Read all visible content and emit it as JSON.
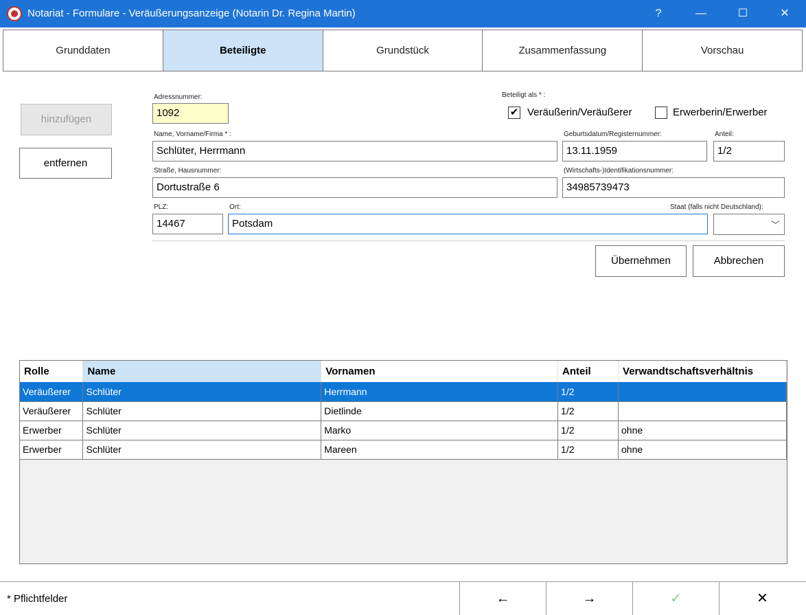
{
  "window": {
    "title": "Notariat - Formulare - Veräußerungsanzeige (Notarin Dr. Regina Martin)",
    "help": "?",
    "minimize": "—",
    "maximize": "☐",
    "close": "✕"
  },
  "tabs": [
    {
      "label": "Grunddaten",
      "active": false
    },
    {
      "label": "Beteiligte",
      "active": true
    },
    {
      "label": "Grundstück",
      "active": false
    },
    {
      "label": "Zusammenfassung",
      "active": false
    },
    {
      "label": "Vorschau",
      "active": false
    }
  ],
  "side_buttons": {
    "add": "hinzufügen",
    "remove": "entfernen"
  },
  "form": {
    "address_number_label": "Adressnummer:",
    "address_number": "1092",
    "role_label": "Beteiligt als * :",
    "seller_label": "Veräußerin/Veräußerer",
    "seller_checked": true,
    "seller_check_glyph": "✔",
    "buyer_label": "Erwerberin/Erwerber",
    "buyer_checked": false,
    "name_label": "Name, Vorname/Firma * :",
    "name": "Schlüter, Herrmann",
    "birthdate_label": "Geburtsdatum/Registernummer:",
    "birthdate": "13.11.1959",
    "share_label": "Anteil:",
    "share": "1/2",
    "street_label": "Straße, Hausnummer:",
    "street": "Dortustraße 6",
    "taxid_label": "(Wirtschafts-)Identifikationsnummer:",
    "taxid": "34985739473",
    "zip_label": "PLZ:",
    "zip": "14467",
    "city_label": "Ort:",
    "city": "Potsdam",
    "country_label": "Staat (falls nicht Deutschland):",
    "country": "",
    "country_arrow": "﹀"
  },
  "actions": {
    "accept": "Übernehmen",
    "cancel": "Abbrechen"
  },
  "table": {
    "columns": [
      "Rolle",
      "Name",
      "Vornamen",
      "Anteil",
      "Verwandtschaftsverhältnis"
    ],
    "rows": [
      {
        "role": "Veräußerer",
        "name": "Schlüter",
        "firstnames": "Herrmann",
        "share": "1/2",
        "relation": "",
        "selected": true
      },
      {
        "role": "Veräußerer",
        "name": "Schlüter",
        "firstnames": "Dietlinde",
        "share": "1/2",
        "relation": "",
        "selected": false
      },
      {
        "role": "Erwerber",
        "name": "Schlüter",
        "firstnames": "Marko",
        "share": "1/2",
        "relation": "ohne",
        "selected": false
      },
      {
        "role": "Erwerber",
        "name": "Schlüter",
        "firstnames": "Mareen",
        "share": "1/2",
        "relation": "ohne",
        "selected": false
      }
    ]
  },
  "footer": {
    "note": "* Pflichtfelder",
    "back": "←",
    "forward": "→",
    "ok": "✓",
    "close": "✕"
  }
}
